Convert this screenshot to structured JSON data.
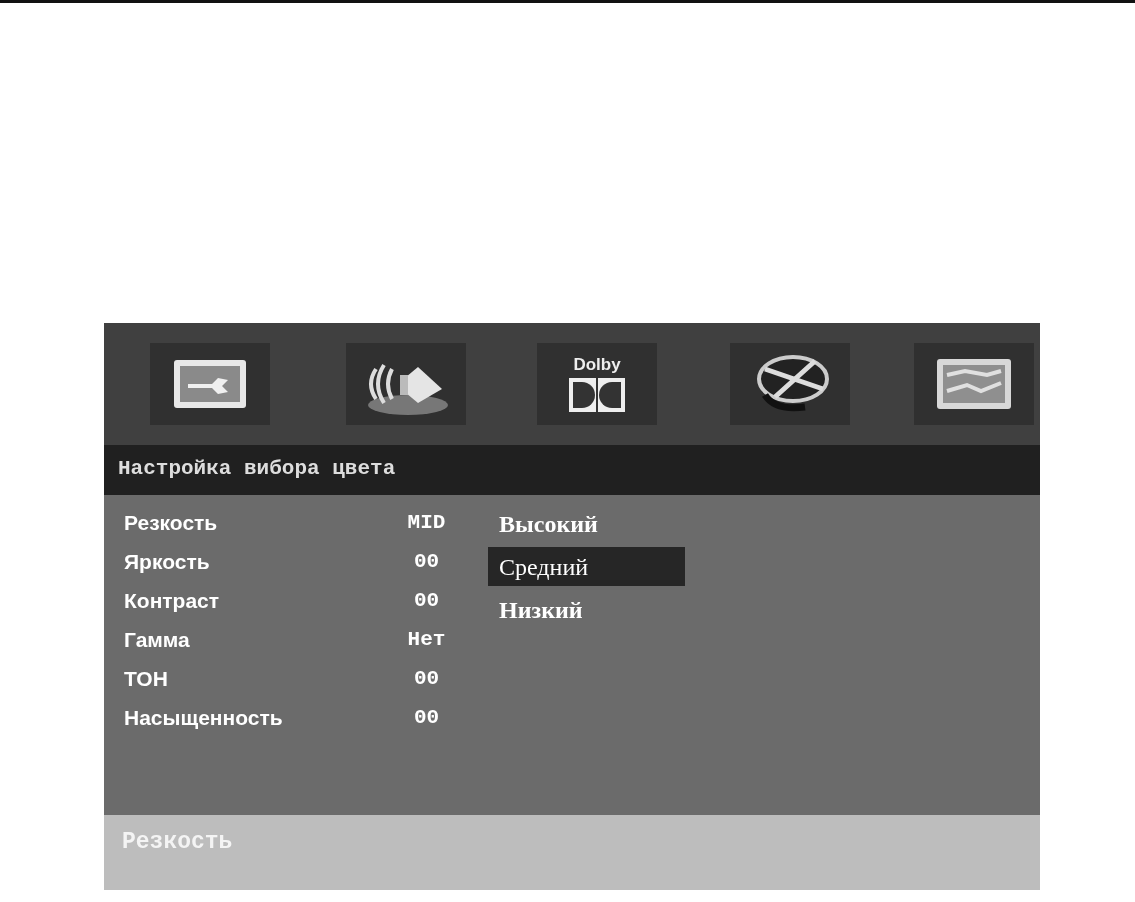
{
  "menu_tabs": [
    {
      "kind": "picture-settings"
    },
    {
      "kind": "sound"
    },
    {
      "kind": "dolby",
      "label": "Dolby"
    },
    {
      "kind": "film"
    },
    {
      "kind": "panel"
    }
  ],
  "section_title": "Настройка вибора цвета",
  "settings": [
    {
      "label": "Резкость",
      "value": "MID"
    },
    {
      "label": "Яркость",
      "value": "00"
    },
    {
      "label": "Контраст",
      "value": "00"
    },
    {
      "label": "Гамма",
      "value": "Нет"
    },
    {
      "label": "ТОН",
      "value": "00"
    },
    {
      "label": "Насыщенность",
      "value": "00"
    }
  ],
  "options": [
    {
      "label": "Высокий",
      "selected": false
    },
    {
      "label": "Средний",
      "selected": true
    },
    {
      "label": "Низкий",
      "selected": false
    }
  ],
  "hint": "Резкость"
}
